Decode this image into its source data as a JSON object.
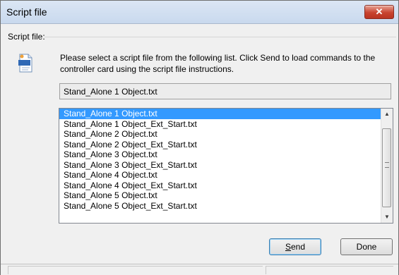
{
  "window": {
    "title": "Script file",
    "close_glyph": "✕"
  },
  "group": {
    "label": "Script file:"
  },
  "description": "Please select a script file from the following list. Click Send to load commands to the controller card using the script file instructions.",
  "selected_file": "Stand_Alone 1 Object.txt",
  "list": {
    "items": [
      "Stand_Alone 1 Object.txt",
      "Stand_Alone 1 Object_Ext_Start.txt",
      "Stand_Alone 2 Object.txt",
      "Stand_Alone 2 Object_Ext_Start.txt",
      "Stand_Alone 3 Object.txt",
      "Stand_Alone 3 Object_Ext_Start.txt",
      "Stand_Alone 4 Object.txt",
      "Stand_Alone 4 Object_Ext_Start.txt",
      "Stand_Alone 5 Object.txt",
      "Stand_Alone 5 Object_Ext_Start.txt"
    ],
    "selected_index": 0
  },
  "buttons": {
    "send_label": "Send",
    "done_label": "Done"
  },
  "icons": {
    "close": "close-icon",
    "document": "script-document-icon",
    "scroll_up": "scroll-up-arrow-icon",
    "scroll_down": "scroll-down-arrow-icon"
  }
}
